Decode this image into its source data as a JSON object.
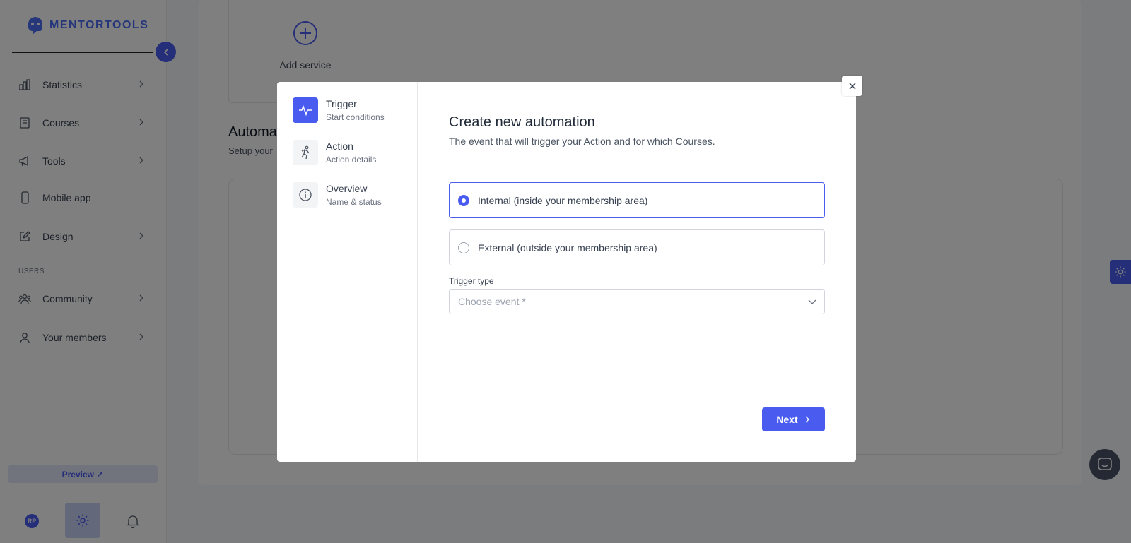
{
  "brand": {
    "name": "MENTORTOOLS",
    "accent": "#4a5cf0"
  },
  "sidebar": {
    "items": [
      {
        "label": "Statistics",
        "icon": "bar-chart-icon",
        "has_chevron": true
      },
      {
        "label": "Courses",
        "icon": "book-icon",
        "has_chevron": true
      },
      {
        "label": "Tools",
        "icon": "megaphone-icon",
        "has_chevron": true
      },
      {
        "label": "Mobile app",
        "icon": "mobile-icon",
        "has_chevron": false
      },
      {
        "label": "Design",
        "icon": "edit-icon",
        "has_chevron": true
      }
    ],
    "section_label": "USERS",
    "user_items": [
      {
        "label": "Community",
        "icon": "people-icon",
        "has_chevron": true
      },
      {
        "label": "Your members",
        "icon": "user-icon",
        "has_chevron": true
      }
    ],
    "preview_label": "Preview ↗",
    "avatar_initials": "RP"
  },
  "background": {
    "add_service_label": "Add service",
    "automations_title": "Automa",
    "automations_sub": "Setup your"
  },
  "modal": {
    "steps": [
      {
        "title": "Trigger",
        "subtitle": "Start conditions",
        "icon": "activity-icon",
        "active": true
      },
      {
        "title": "Action",
        "subtitle": "Action details",
        "icon": "running-icon",
        "active": false
      },
      {
        "title": "Overview",
        "subtitle": "Name & status",
        "icon": "info-icon",
        "active": false
      }
    ],
    "title": "Create new automation",
    "subtitle": "The event that will trigger your Action and for which Courses.",
    "options": [
      {
        "label": "Internal (inside your membership area)",
        "selected": true
      },
      {
        "label": "External (outside your membership area)",
        "selected": false
      }
    ],
    "trigger_type_label": "Trigger type",
    "trigger_type_placeholder": "Choose event *",
    "next_label": "Next"
  }
}
